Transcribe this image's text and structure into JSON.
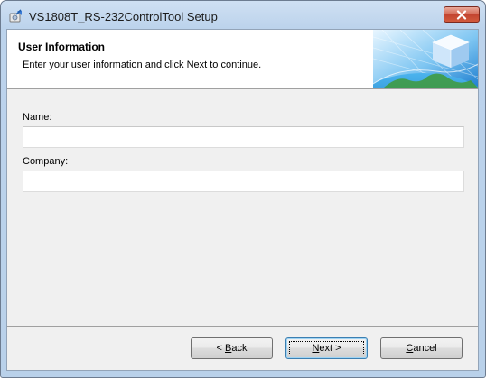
{
  "window": {
    "title": "VS1808T_RS-232ControlTool Setup",
    "app_icon": "installer-icon",
    "close_icon": "close-icon"
  },
  "banner": {
    "title": "User Information",
    "subtitle": "Enter your user information and click Next to continue.",
    "art": "cube-globe-banner-art"
  },
  "form": {
    "name_label": "Name:",
    "name_value": "",
    "company_label": "Company:",
    "company_value": ""
  },
  "buttons": {
    "back": {
      "label": "< Back",
      "underline": "B"
    },
    "next": {
      "label": "Next >",
      "underline": "N",
      "default": true
    },
    "cancel": {
      "label": "Cancel",
      "underline": "C"
    }
  },
  "colors": {
    "titlebar": "#bcd3ec",
    "close_button": "#c24430",
    "dialog_bg": "#f0f0f0",
    "default_button_border": "#3c7fb1"
  }
}
